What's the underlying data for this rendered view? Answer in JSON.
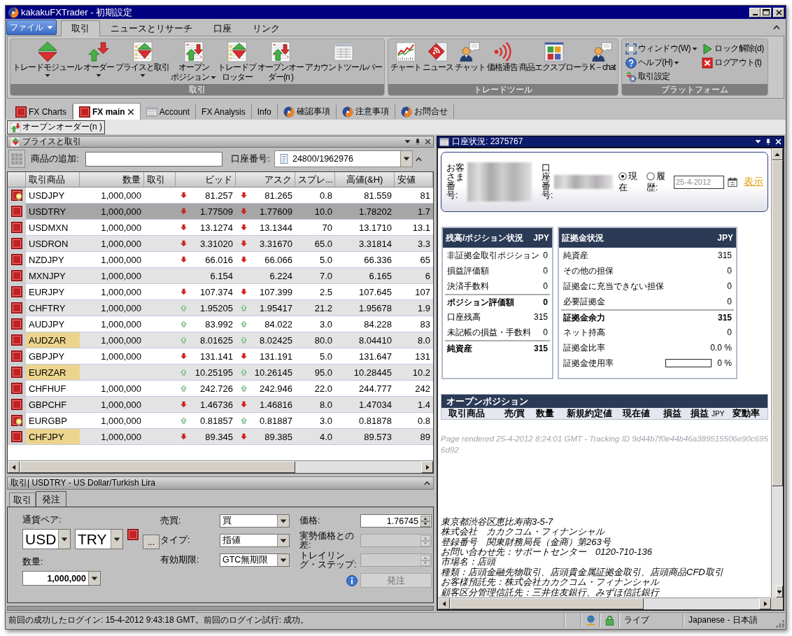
{
  "window": {
    "title": "kakakuFXTrader - 初期設定"
  },
  "menu": {
    "file": "ファイル",
    "tabs": [
      {
        "label": "取引",
        "selected": true
      },
      {
        "label": "ニュースとリサーチ",
        "selected": false
      },
      {
        "label": "口座",
        "selected": false
      },
      {
        "label": "リンク",
        "selected": false
      }
    ]
  },
  "ribbon": [
    {
      "title": "取引",
      "kind": "large",
      "items": [
        {
          "kind": "module",
          "lines": [
            "トレードモジュール"
          ],
          "dropdown": true
        },
        {
          "kind": "order",
          "lines": [
            "オーダー"
          ],
          "dropdown": true
        },
        {
          "kind": "prices",
          "lines": [
            "プライスと取引"
          ],
          "dropdown": true
        },
        {
          "kind": "positions",
          "lines": [
            "オープン",
            "ポジション"
          ],
          "dropdown": true
        },
        {
          "kind": "blotter",
          "lines": [
            "トレードブ",
            "ロッター"
          ],
          "dropdown": false
        },
        {
          "kind": "orders",
          "lines": [
            "オープンオー",
            "ダー(n )"
          ],
          "dropdown": false
        },
        {
          "kind": "account",
          "lines": [
            "アカウントツールバー"
          ],
          "dropdown": false
        }
      ]
    },
    {
      "title": "トレードツール",
      "kind": "large",
      "items": [
        {
          "kind": "chart",
          "lines": [
            "チャート"
          ],
          "dropdown": false
        },
        {
          "kind": "news",
          "lines": [
            "ニュース"
          ],
          "dropdown": false
        },
        {
          "kind": "chat",
          "lines": [
            "チャット"
          ],
          "dropdown": false
        },
        {
          "kind": "alert",
          "lines": [
            "価格通告"
          ],
          "dropdown": false
        },
        {
          "kind": "explorer",
          "lines": [
            "商品エクスプローラ"
          ],
          "dropdown": false
        },
        {
          "kind": "chat",
          "lines": [
            "K－chat"
          ],
          "dropdown": false
        }
      ]
    },
    {
      "title": "プラットフォーム",
      "kind": "small",
      "items": [
        {
          "kind": "window",
          "label": "ウィンドウ(W)",
          "dropdown": true
        },
        {
          "kind": "unlock",
          "label": "ロック解除(d)",
          "dropdown": false
        },
        {
          "kind": "help",
          "label": "ヘルプ(H)",
          "dropdown": true
        },
        {
          "kind": "logout",
          "label": "ログアウト(t)",
          "dropdown": false
        },
        {
          "kind": "settings",
          "label": "取引設定",
          "dropdown": false
        }
      ]
    }
  ],
  "doc_tabs": [
    {
      "label": "FX Charts",
      "kind": "fx",
      "selected": false,
      "closable": false
    },
    {
      "label": "FX main",
      "kind": "fx",
      "selected": true,
      "closable": true
    },
    {
      "label": "Account",
      "kind": "table",
      "selected": false,
      "closable": false
    },
    {
      "label": "FX Analysis",
      "kind": "none",
      "selected": false,
      "closable": false
    },
    {
      "label": "Info",
      "kind": "none",
      "selected": false,
      "closable": false
    },
    {
      "label": "確認事項",
      "kind": "swirl",
      "selected": false,
      "closable": false
    },
    {
      "label": "注意事項",
      "kind": "swirl",
      "selected": false,
      "closable": false
    },
    {
      "label": "お問合せ",
      "kind": "swirl",
      "selected": false,
      "closable": false
    }
  ],
  "toolbar": {
    "button": "オープンオーダー(n )"
  },
  "prices": {
    "title": "プライスと取引",
    "add_label": "商品の追加:",
    "account_label": "口座番号:",
    "account": "24800/1962976",
    "columns": [
      "取引商品",
      "数量",
      "取引",
      "ビッド",
      "アスク",
      "スプレ...",
      "高値(&H)",
      "安値"
    ],
    "rows": [
      {
        "kind": "fx_bulb",
        "symbol": "USDJPY",
        "highlighted": false,
        "selected": false,
        "quantity": "1,000,000",
        "bid_up": false,
        "bid_down": true,
        "bid": "81.257",
        "ask_up": false,
        "ask_down": true,
        "ask": "81.265",
        "spread": "0.8",
        "high": "81.559",
        "low": "81"
      },
      {
        "kind": "fx",
        "symbol": "USDTRY",
        "highlighted": false,
        "selected": true,
        "quantity": "1,000,000",
        "bid_up": false,
        "bid_down": true,
        "bid": "1.77509",
        "ask_up": false,
        "ask_down": true,
        "ask": "1.77609",
        "spread": "10.0",
        "high": "1.78202",
        "low": "1.7"
      },
      {
        "kind": "fx",
        "symbol": "USDMXN",
        "highlighted": false,
        "selected": false,
        "quantity": "1,000,000",
        "bid_up": false,
        "bid_down": true,
        "bid": "13.1274",
        "ask_up": false,
        "ask_down": true,
        "ask": "13.1344",
        "spread": "70",
        "high": "13.1710",
        "low": "13.1"
      },
      {
        "kind": "fx",
        "symbol": "USDRON",
        "highlighted": false,
        "selected": false,
        "quantity": "1,000,000",
        "bid_up": false,
        "bid_down": true,
        "bid": "3.31020",
        "ask_up": false,
        "ask_down": true,
        "ask": "3.31670",
        "spread": "65.0",
        "high": "3.31814",
        "low": "3.3"
      },
      {
        "kind": "fx",
        "symbol": "NZDJPY",
        "highlighted": false,
        "selected": false,
        "quantity": "1,000,000",
        "bid_up": false,
        "bid_down": true,
        "bid": "66.016",
        "ask_up": false,
        "ask_down": true,
        "ask": "66.066",
        "spread": "5.0",
        "high": "66.336",
        "low": "65"
      },
      {
        "kind": "fx",
        "symbol": "MXNJPY",
        "highlighted": false,
        "selected": false,
        "quantity": "1,000,000",
        "bid_up": false,
        "bid_down": false,
        "bid": "6.154",
        "ask_up": false,
        "ask_down": false,
        "ask": "6.224",
        "spread": "7.0",
        "high": "6.165",
        "low": "6"
      },
      {
        "kind": "fx",
        "symbol": "EURJPY",
        "highlighted": false,
        "selected": false,
        "quantity": "1,000,000",
        "bid_up": false,
        "bid_down": true,
        "bid": "107.374",
        "ask_up": false,
        "ask_down": true,
        "ask": "107.399",
        "spread": "2.5",
        "high": "107.645",
        "low": "107"
      },
      {
        "kind": "fx",
        "symbol": "CHFTRY",
        "highlighted": false,
        "selected": false,
        "quantity": "1,000,000",
        "bid_up": true,
        "bid_down": false,
        "bid": "1.95205",
        "ask_up": true,
        "ask_down": false,
        "ask": "1.95417",
        "spread": "21.2",
        "high": "1.95678",
        "low": "1.9"
      },
      {
        "kind": "fx",
        "symbol": "AUDJPY",
        "highlighted": false,
        "selected": false,
        "quantity": "1,000,000",
        "bid_up": true,
        "bid_down": false,
        "bid": "83.992",
        "ask_up": true,
        "ask_down": false,
        "ask": "84.022",
        "spread": "3.0",
        "high": "84.228",
        "low": "83"
      },
      {
        "kind": "fx",
        "symbol": "AUDZAR",
        "highlighted": true,
        "selected": false,
        "quantity": "1,000,000",
        "bid_up": true,
        "bid_down": false,
        "bid": "8.01625",
        "ask_up": true,
        "ask_down": false,
        "ask": "8.02425",
        "spread": "80.0",
        "high": "8.04410",
        "low": "8.0"
      },
      {
        "kind": "fx",
        "symbol": "GBPJPY",
        "highlighted": false,
        "selected": false,
        "quantity": "1,000,000",
        "bid_up": false,
        "bid_down": true,
        "bid": "131.141",
        "ask_up": false,
        "ask_down": true,
        "ask": "131.191",
        "spread": "5.0",
        "high": "131.647",
        "low": "131"
      },
      {
        "kind": "fx",
        "symbol": "EURZAR",
        "highlighted": true,
        "selected": false,
        "bid_up": true,
        "bid_down": false,
        "bid": "10.25195",
        "ask_up": true,
        "ask_down": false,
        "ask": "10.26145",
        "spread": "95.0",
        "high": "10.28445",
        "low": "10.2"
      },
      {
        "kind": "fx",
        "symbol": "CHFHUF",
        "highlighted": false,
        "selected": false,
        "quantity": "1,000,000",
        "bid_up": true,
        "bid_down": false,
        "bid": "242.726",
        "ask_up": true,
        "ask_down": false,
        "ask": "242.946",
        "spread": "22.0",
        "high": "244.777",
        "low": "242"
      },
      {
        "kind": "fx",
        "symbol": "GBPCHF",
        "highlighted": false,
        "selected": false,
        "quantity": "1,000,000",
        "bid_up": false,
        "bid_down": true,
        "bid": "1.46736",
        "ask_up": false,
        "ask_down": true,
        "ask": "1.46816",
        "spread": "8.0",
        "high": "1.47034",
        "low": "1.4"
      },
      {
        "kind": "fx_bulb",
        "symbol": "EURGBP",
        "highlighted": false,
        "selected": false,
        "quantity": "1,000,000",
        "bid_up": true,
        "bid_down": false,
        "bid": "0.81857",
        "ask_up": true,
        "ask_down": false,
        "ask": "0.81887",
        "spread": "3.0",
        "high": "0.81878",
        "low": "0.8"
      },
      {
        "kind": "fx",
        "symbol": "CHFJPY",
        "highlighted": true,
        "selected": false,
        "quantity": "1,000,000",
        "bid_up": false,
        "bid_down": true,
        "bid": "89.345",
        "ask_up": false,
        "ask_down": true,
        "ask": "89.385",
        "spread": "4.0",
        "high": "89.573",
        "low": "89"
      }
    ]
  },
  "order": {
    "title": "取引| USDTRY - US Dollar/Turkish Lira",
    "tabs": [
      {
        "label": "取引",
        "selected": false
      },
      {
        "label": "発注",
        "selected": true
      }
    ],
    "pair_label": "通貨ペア:",
    "base": "USD",
    "quote": "TRY",
    "more": "...",
    "quantity_label": "数量:",
    "quantity": "1,000,000",
    "fields": [
      {
        "label": "売買:",
        "value": "買"
      },
      {
        "label": "タイプ:",
        "value": "指値"
      },
      {
        "label": "有効期限:",
        "value": "GTC無期限"
      }
    ],
    "spinners": [
      {
        "label": "価格:",
        "value": "1.76745",
        "disabled": false
      },
      {
        "label": "実勢価格との差:",
        "disabled": true
      },
      {
        "label": "トレイリング・ステップ:",
        "disabled": true
      }
    ],
    "submit": {
      "label": "発注",
      "disabled": true
    }
  },
  "account": {
    "title": "口座状況: 2375767",
    "customer_label": "お客さま番号:",
    "account_label": "口座番号:",
    "modes": [
      {
        "label": "現在",
        "selected": true
      },
      {
        "label": "履歴:",
        "selected": false
      }
    ],
    "date": "25-4-2012",
    "show": "表示",
    "balance": {
      "title": "残高/ポジション状況",
      "currency": "JPY",
      "rows": [
        {
          "kind": "value",
          "label": "非証拠金取引ポジション",
          "value": "0",
          "total": false
        },
        {
          "kind": "value",
          "label": "損益評価額",
          "value": "0",
          "total": false
        },
        {
          "kind": "value",
          "label": "決済手数料",
          "value": "0",
          "total": false
        },
        {
          "kind": "value",
          "label": "ポジション評価額",
          "value": "0",
          "total": true
        },
        {
          "kind": "value",
          "label": "口座残高",
          "value": "315",
          "total": false
        },
        {
          "kind": "value",
          "label": "未記帳の損益・手数料",
          "value": "0",
          "total": false
        },
        {
          "kind": "value",
          "label": "純資産",
          "value": "315",
          "total": true
        }
      ]
    },
    "margin": {
      "title": "証拠金状況",
      "currency": "JPY",
      "rows": [
        {
          "kind": "value",
          "label": "純資産",
          "value": "315",
          "total": false
        },
        {
          "kind": "value",
          "label": "その他の担保",
          "value": "0",
          "total": false
        },
        {
          "kind": "value",
          "label": "証拠金に充当できない担保",
          "value": "0",
          "total": false
        },
        {
          "kind": "value",
          "label": "必要証拠金",
          "value": "0",
          "total": false
        },
        {
          "kind": "value",
          "label": "証拠金余力",
          "value": "315",
          "total": true
        },
        {
          "kind": "value",
          "label": "ネット持高",
          "value": "0",
          "total": false
        },
        {
          "kind": "value",
          "label": "証拠金比率",
          "value": "0.0 %",
          "total": false
        },
        {
          "kind": "meter",
          "label": "証拠金使用率",
          "value": "0 %",
          "level": 0,
          "total": false
        }
      ]
    },
    "open_positions": {
      "title": "オープンポジション",
      "columns": [
        {
          "label": "取引商品"
        },
        {
          "label": "売/買"
        },
        {
          "label": "数量"
        },
        {
          "label": "新規約定値"
        },
        {
          "label": "現在値"
        },
        {
          "label": "損益"
        },
        {
          "label": "損益",
          "unit": "JPY"
        },
        {
          "label": "変動率"
        }
      ]
    },
    "note": "Page rendered 25-4-2012 8:24:01 GMT - Tracking ID 9d44b7f0e44b46a389515506e90c6956d92",
    "company": [
      "東京都渋谷区恵比寿南3-5-7",
      "株式会社　カカクコム・フィナンシャル",
      "登録番号　関東財務局長（金商）第263号",
      "お問い合わせ先：サポートセンター　0120-710-136",
      "市場名：店頭",
      "種類：店頭金融先物取引、店頭貴金属証拠金取引、店頭商品CFD取引",
      "お客様預託先：株式会社カカクコム・フィナンシャル",
      "顧客区分管理信託先：三井住友銀行、みずほ信託銀行"
    ]
  },
  "status_bar": {
    "message": "前回の成功したログイン: 15-4-2012 9:43:18 GMT。前回のログイン試行: 成功。",
    "mode": "ライブ",
    "language": "Japanese - 日本語"
  }
}
